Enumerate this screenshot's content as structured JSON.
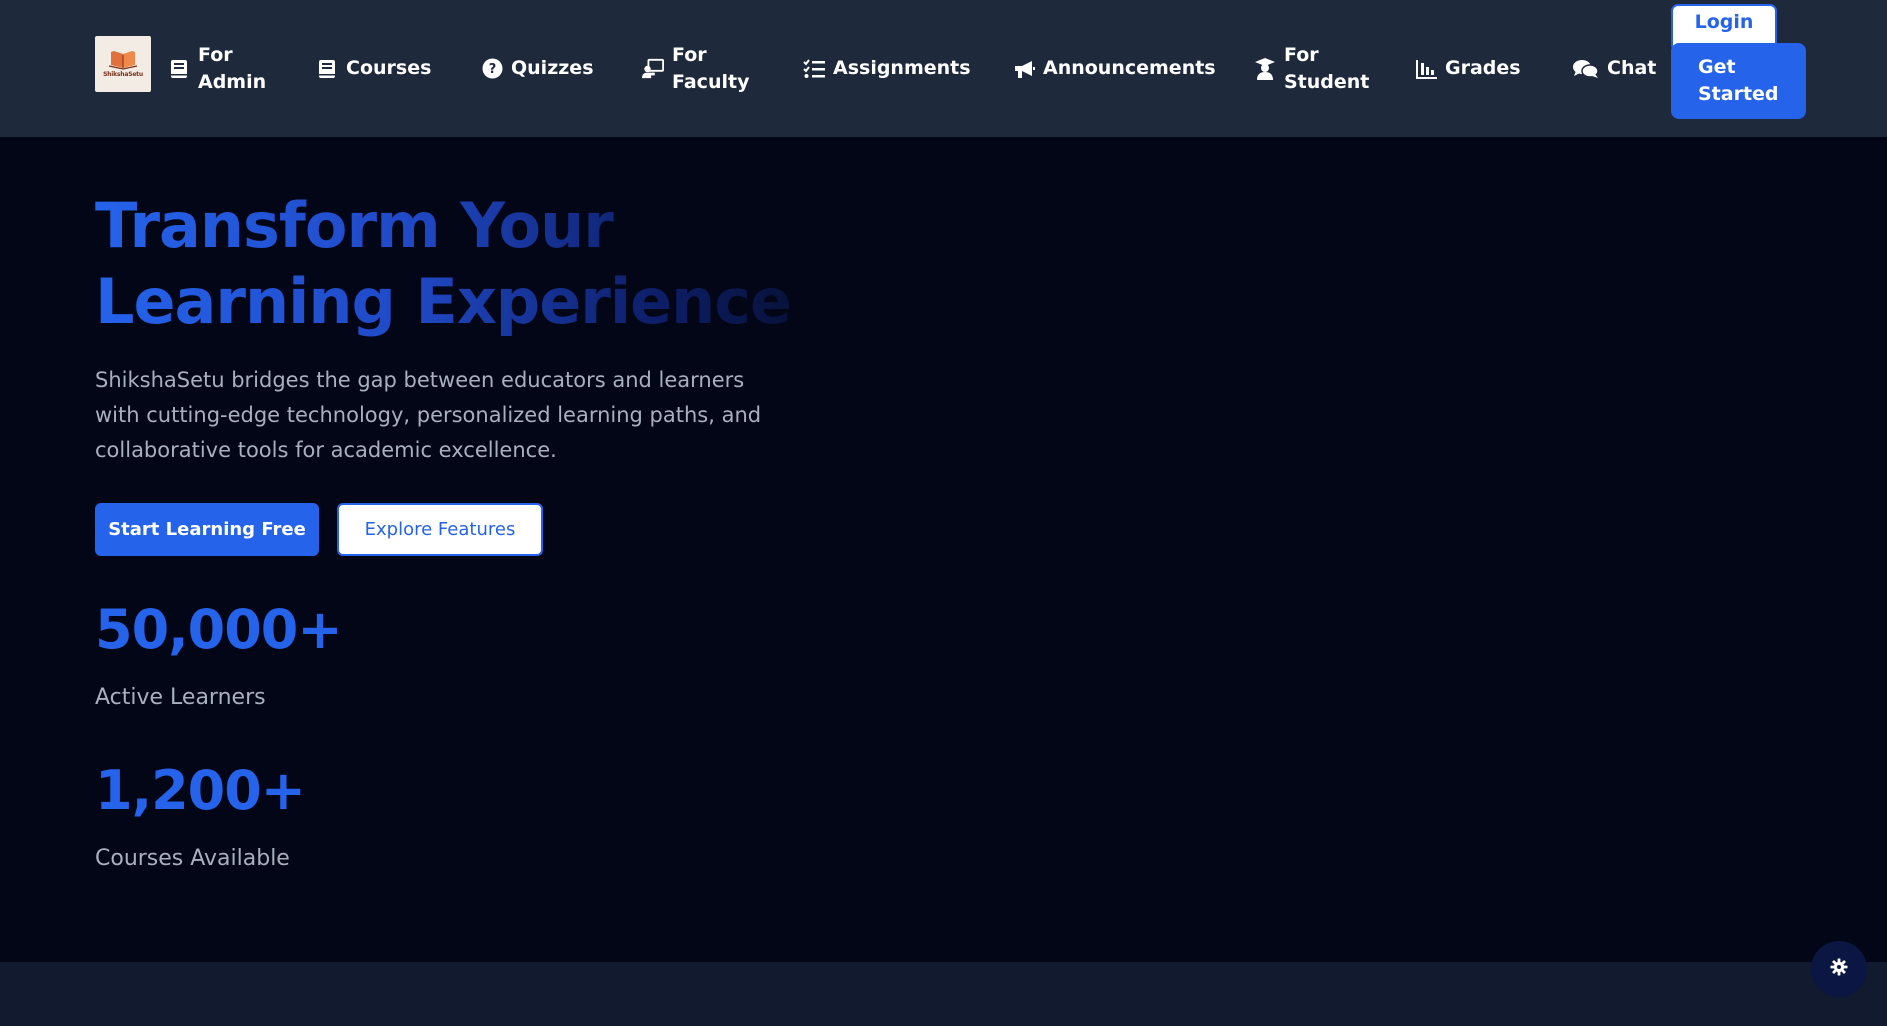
{
  "brand": {
    "name": "ShikshaSetu",
    "logo_text": "ShikshaSetu"
  },
  "nav": {
    "items": [
      {
        "label": "For Admin",
        "icon": "book-icon"
      },
      {
        "label": "Courses",
        "icon": "book-icon"
      },
      {
        "label": "Quizzes",
        "icon": "question-circle-icon"
      },
      {
        "label": "For Faculty",
        "icon": "chalkboard-teacher-icon"
      },
      {
        "label": "Assignments",
        "icon": "task-list-icon"
      },
      {
        "label": "Announcements",
        "icon": "megaphone-icon"
      },
      {
        "label": "For Student",
        "icon": "graduate-icon"
      },
      {
        "label": "Grades",
        "icon": "bar-chart-icon"
      },
      {
        "label": "Chat",
        "icon": "chat-bubbles-icon"
      }
    ],
    "login_label": "Login",
    "get_started_label": "Get Started"
  },
  "hero": {
    "title_line1": "Transform Your",
    "title_line2": "Learning Experience",
    "description": "ShikshaSetu bridges the gap between educators and learners with cutting-edge technology, personalized learning paths, and collaborative tools for academic excellence.",
    "primary_button": "Start Learning Free",
    "secondary_button": "Explore Features",
    "stats": [
      {
        "value": "50,000+",
        "label": "Active Learners"
      },
      {
        "value": "1,200+",
        "label": "Courses Available"
      }
    ]
  },
  "settings_button": {
    "icon": "gear-icon"
  },
  "colors": {
    "accent": "#2563eb",
    "navbar_bg": "#1e293b",
    "hero_bg": "#030617",
    "text_muted": "#a8b0bd"
  }
}
